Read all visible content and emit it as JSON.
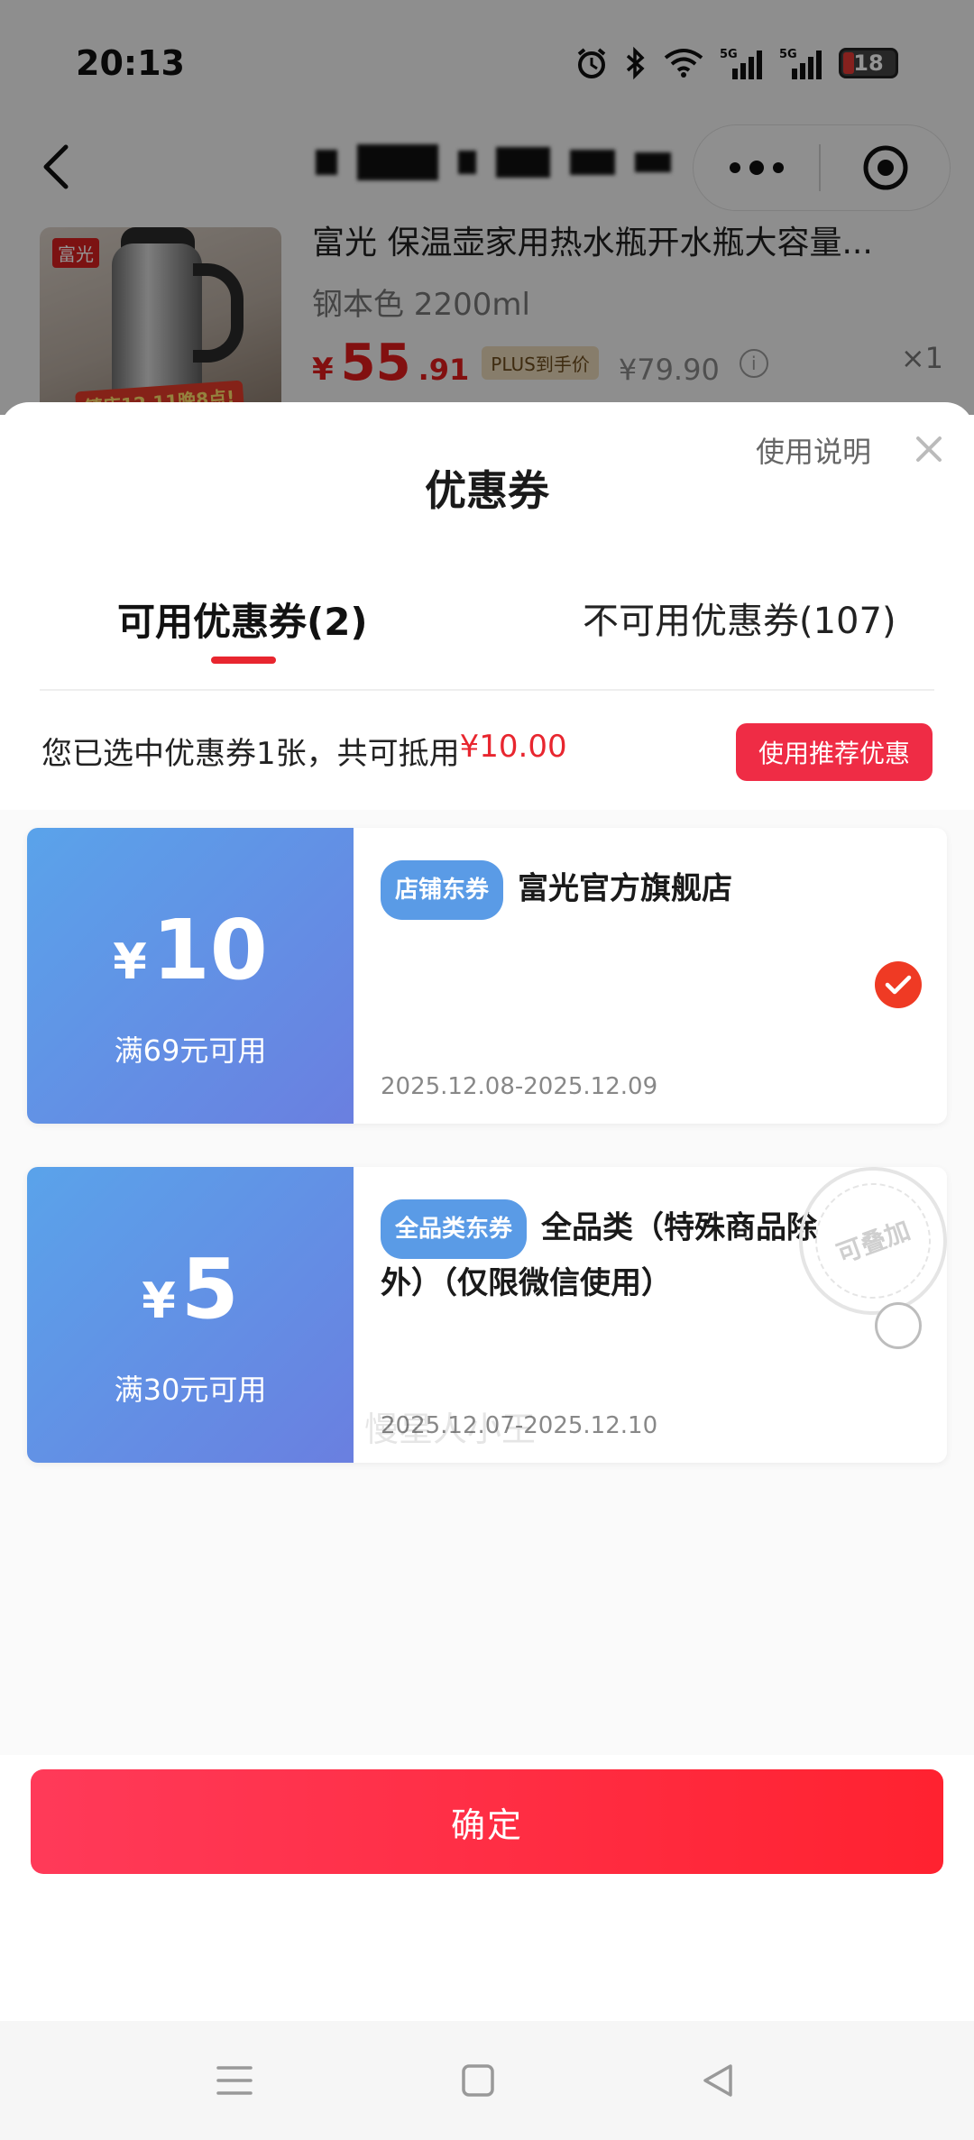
{
  "status_bar": {
    "time": "20:13",
    "battery": "18",
    "icons": [
      "alarm-icon",
      "bluetooth-icon",
      "wifi-icon",
      "signal-5g-icon",
      "signal-5g-icon",
      "battery-icon"
    ]
  },
  "nav": {
    "back_icon": "chevron-left-icon",
    "more_icon": "more-dots-icon",
    "close_icon": "target-icon"
  },
  "product": {
    "brand_tag": "富光",
    "promo_text": "镇店12.11晚8点!",
    "title": "富光 保温壶家用热水瓶开水瓶大容量...",
    "spec": "钢本色 2200ml",
    "currency": "¥",
    "price_int": "55",
    "price_dec": ".91",
    "plus_tag": "PLUS到手价",
    "original_price": "¥79.90",
    "quantity": "×1"
  },
  "sheet": {
    "title": "优惠券",
    "usage_link": "使用说明",
    "tabs": [
      {
        "label": "可用优惠券(2)",
        "active": true
      },
      {
        "label": "不可用优惠券(107)",
        "active": false
      }
    ],
    "summary_prefix": "您已选中优惠券1张，共可抵用",
    "summary_amount": "¥10.00",
    "recommend_button": "使用推荐优惠",
    "watermark": "慢星人小王",
    "confirm_button": "确定"
  },
  "coupons": [
    {
      "currency": "¥",
      "value": "10",
      "condition": "满69元可用",
      "tag": "店铺东券",
      "name": "富光官方旗舰店",
      "date": "2025.12.08-2025.12.09",
      "selected": true
    },
    {
      "currency": "¥",
      "value": "5",
      "condition": "满30元可用",
      "tag": "全品类东券",
      "name": "全品类（特殊商品除外）（仅限微信使用）",
      "date": "2025.12.07-2025.12.10",
      "selected": false,
      "stamp": "可叠加"
    }
  ],
  "colors": {
    "accent_red": "#e8262f",
    "coupon_blue": "#5aa3ea",
    "confirm_red": "#ff2c45"
  }
}
